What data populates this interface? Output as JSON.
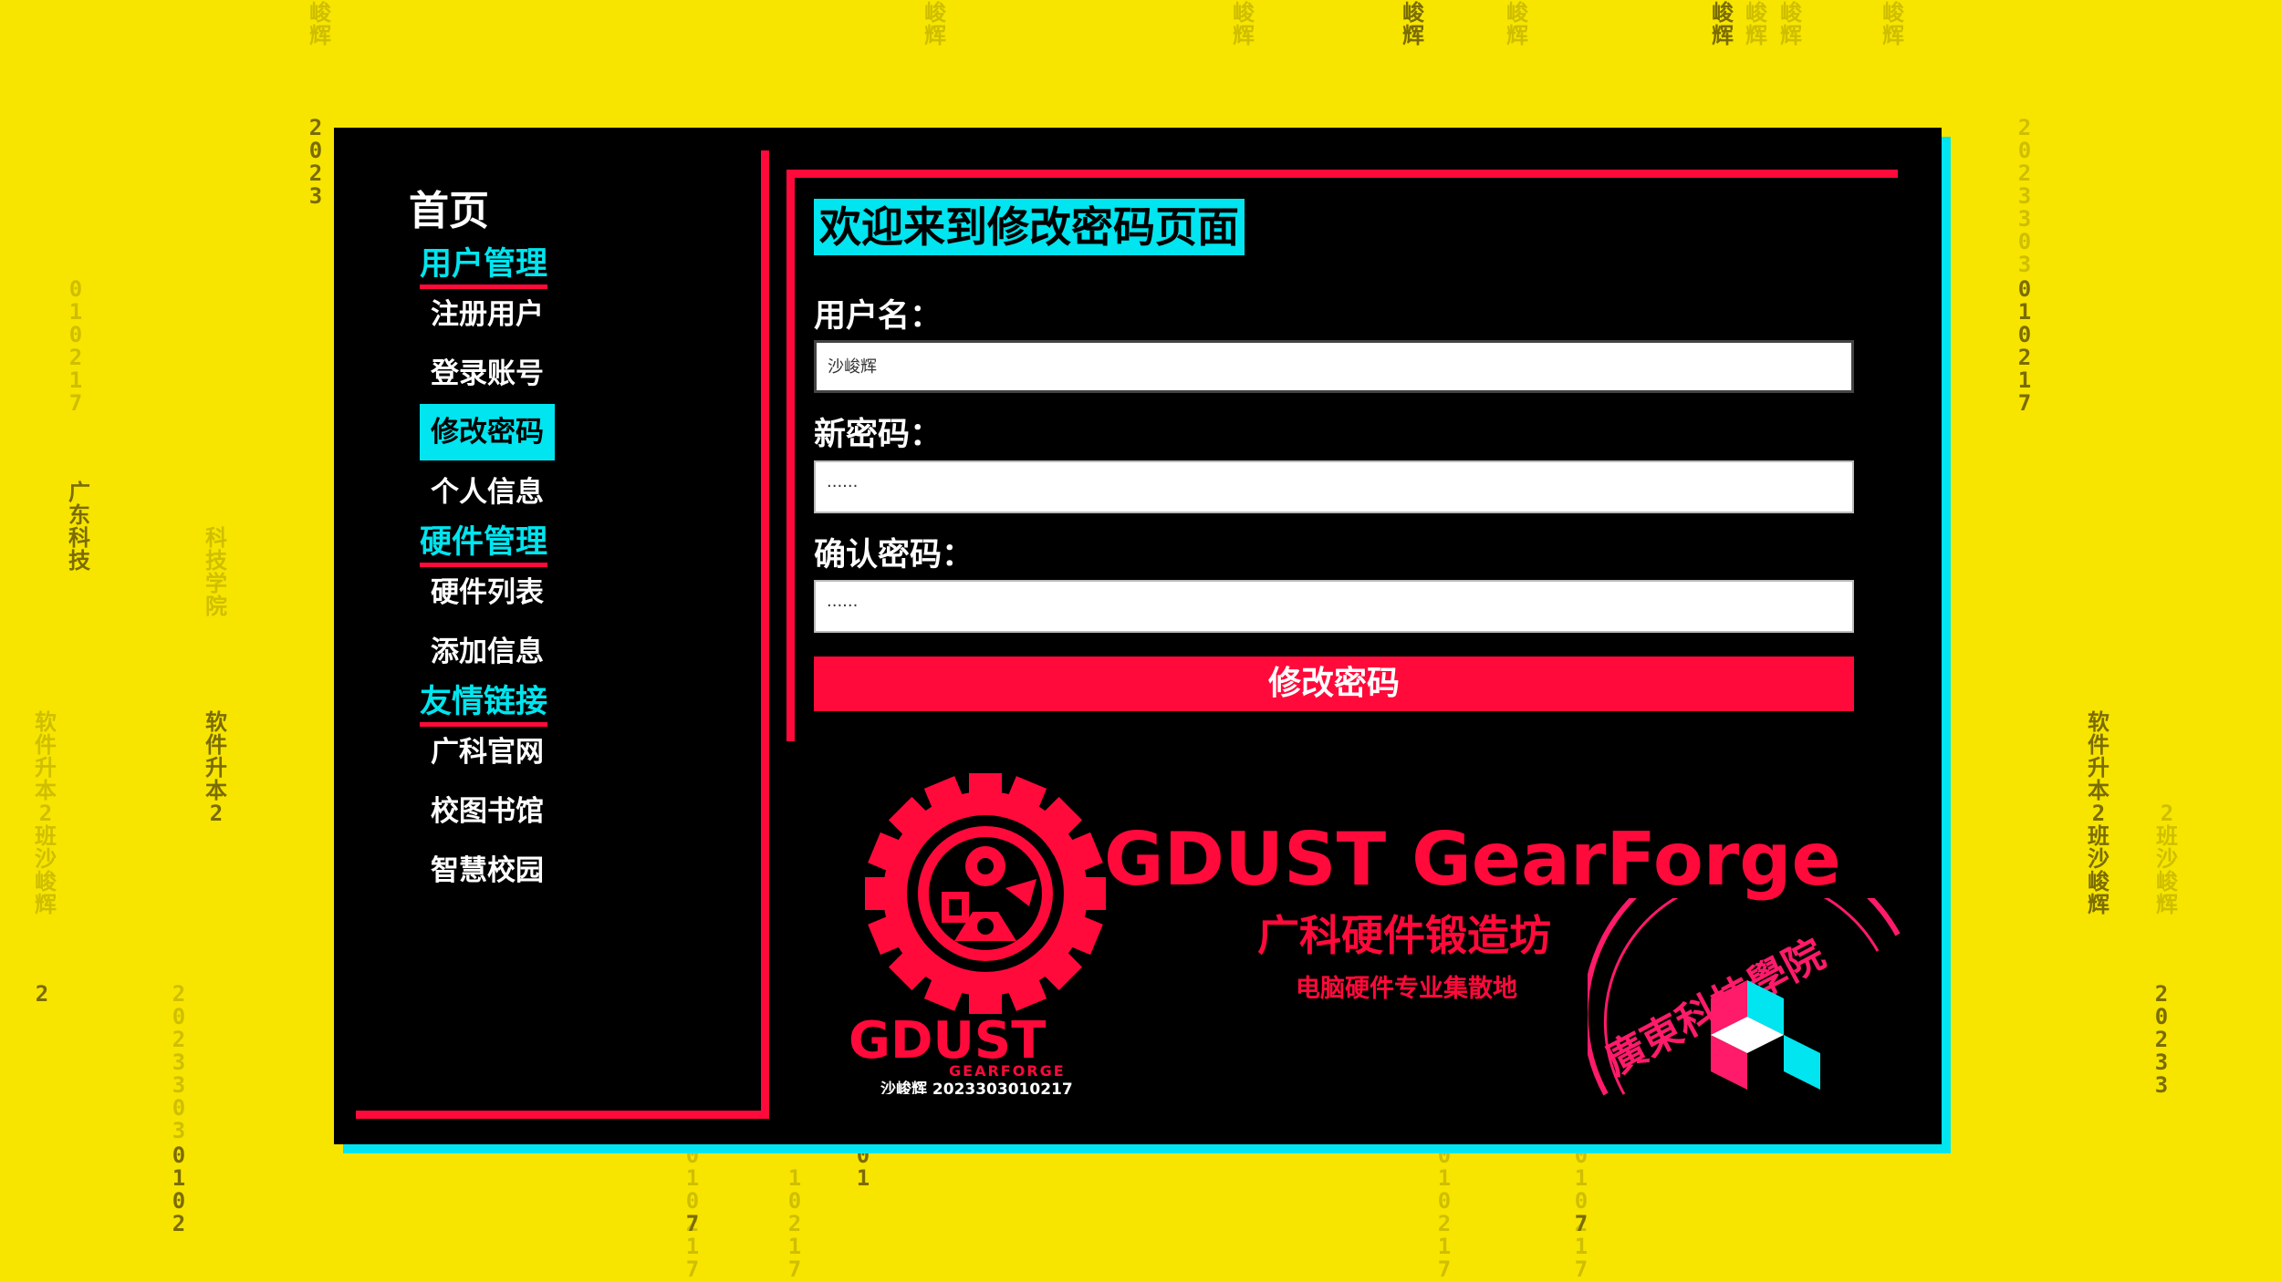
{
  "background_rain": {
    "chars": [
      "峻辉",
      "2023",
      "01021",
      "0102102",
      "软件升本2班沙峻辉",
      "广东科技",
      "科技学院",
      "2",
      "1",
      "0102102",
      "软件升本2",
      "20233030102",
      "2",
      "20233",
      "0102",
      "2",
      "2",
      "2"
    ]
  },
  "nav": {
    "home": "首页",
    "groups": [
      {
        "label": "用户管理",
        "items": [
          "注册用户",
          "登录账号",
          "修改密码",
          "个人信息"
        ]
      },
      {
        "label": "硬件管理",
        "items": [
          "硬件列表",
          "添加信息"
        ]
      },
      {
        "label": "友情链接",
        "items": [
          "广科官网",
          "校图书馆",
          "智慧校园"
        ]
      }
    ],
    "active": "修改密码"
  },
  "form": {
    "title": "欢迎来到修改密码页面",
    "username_label": "用户名：",
    "username_value": "沙峻辉",
    "new_password_label": "新密码：",
    "new_password_value": "······",
    "confirm_password_label": "确认密码：",
    "confirm_password_value": "······",
    "submit_label": "修改密码"
  },
  "branding": {
    "logo_text": "GDUST",
    "logo_subtext": "GEARFORGE",
    "logo_caption": "沙峻辉 2023303010217",
    "brand_title": "GDUST GearForge",
    "brand_subtitle": "广科硬件锻造坊",
    "brand_tagline": "电脑硬件专业集散地",
    "stamp_text": "廣東科技學院"
  },
  "colors": {
    "background": "#f7e500",
    "window": "#000000",
    "accent_red": "#ff0a3a",
    "accent_cyan": "#00e5ef"
  }
}
